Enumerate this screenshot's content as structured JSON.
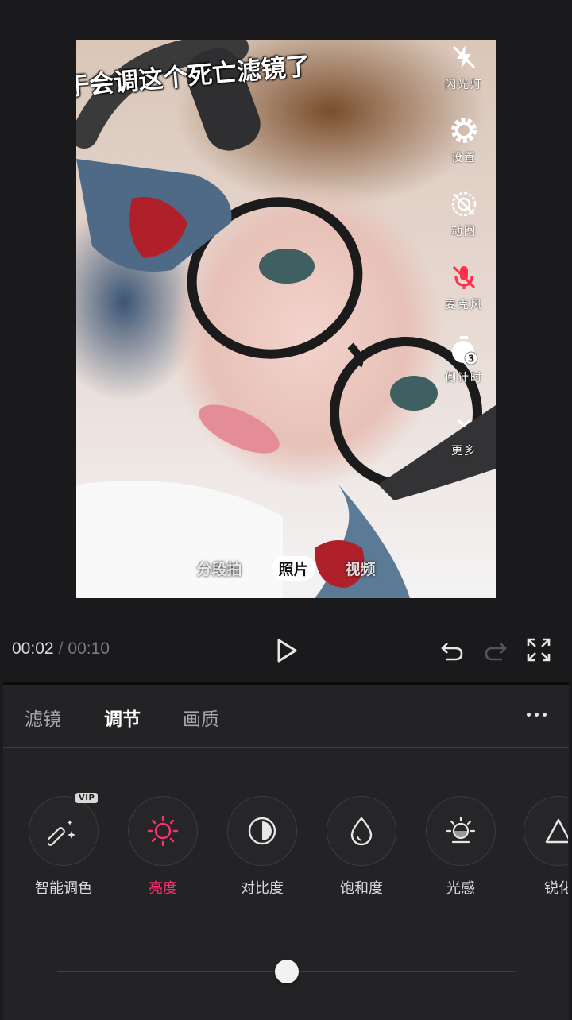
{
  "preview": {
    "caption": "终于会调这个死亡滤镜了",
    "side_tools": [
      {
        "id": "flash",
        "label": "闪光灯",
        "icon": "flash-off-icon"
      },
      {
        "id": "settings",
        "label": "设置",
        "icon": "gear-icon"
      },
      {
        "id": "gif",
        "label": "动图",
        "icon": "gif-off-icon"
      },
      {
        "id": "mic",
        "label": "麦克风",
        "icon": "mic-off-icon",
        "color": "#ff2e4d"
      },
      {
        "id": "timer",
        "label": "倒计时",
        "icon": "timer-icon",
        "badge": "3"
      },
      {
        "id": "more",
        "label": "更多",
        "icon": "chevron-down-icon"
      }
    ],
    "modes": [
      "分段拍",
      "照片",
      "视频"
    ],
    "active_mode": "照片"
  },
  "playback": {
    "current": "00:02",
    "separator": "/",
    "total": "00:10"
  },
  "panel": {
    "tabs": [
      "滤镜",
      "调节",
      "画质"
    ],
    "active_tab": "调节",
    "tools": [
      {
        "label": "智能调色",
        "icon": "magic-wand-icon",
        "vip": "VIP"
      },
      {
        "label": "亮度",
        "icon": "brightness-icon",
        "active": true
      },
      {
        "label": "对比度",
        "icon": "contrast-icon"
      },
      {
        "label": "饱和度",
        "icon": "saturation-drop-icon"
      },
      {
        "label": "光感",
        "icon": "light-sense-icon"
      },
      {
        "label": "锐化",
        "icon": "sharpen-triangle-icon"
      }
    ],
    "slider_value": 0.5
  },
  "colors": {
    "accent": "#ff2e72",
    "background": "#1a1a1c",
    "panel": "#232325"
  }
}
